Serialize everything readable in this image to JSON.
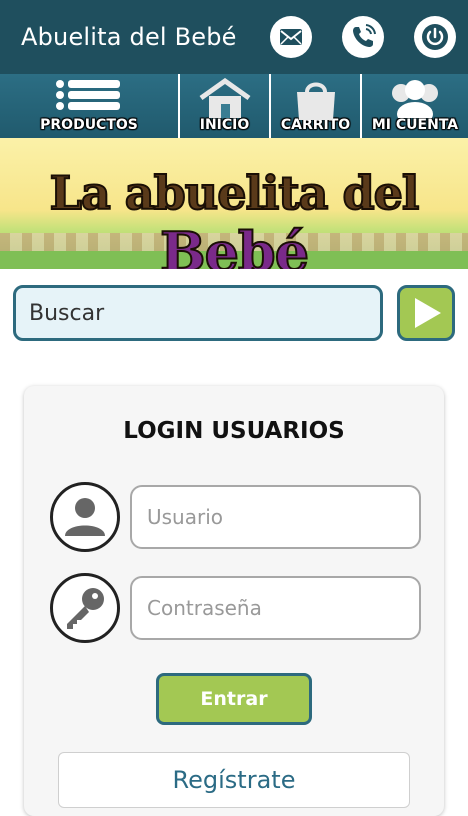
{
  "header": {
    "title": "Abuelita del Bebé",
    "bg_color": "#1f4f5e",
    "buttons": [
      {
        "icon": "mail-icon"
      },
      {
        "icon": "phone-icon"
      },
      {
        "icon": "power-icon"
      }
    ]
  },
  "nav": {
    "items": [
      {
        "label": "PRODUCTOS",
        "icon": "menu-list-icon"
      },
      {
        "label": "INICIO",
        "icon": "house-icon"
      },
      {
        "label": "CARRITO",
        "icon": "shopping-bag-icon"
      },
      {
        "label": "MI CUENTA",
        "icon": "users-icon"
      }
    ]
  },
  "banner": {
    "text_part1": "La abuelita del",
    "text_part2": "Bebé"
  },
  "search": {
    "placeholder": "Buscar",
    "button_icon": "play-arrow-icon",
    "accent": "#a3c853",
    "border": "#2d6a7e"
  },
  "login": {
    "title": "LOGIN USUARIOS",
    "user_placeholder": "Usuario",
    "password_placeholder": "Contraseña",
    "submit_label": "Entrar",
    "register_label": "Regístrate",
    "user_icon": "person-icon",
    "password_icon": "key-icon"
  }
}
